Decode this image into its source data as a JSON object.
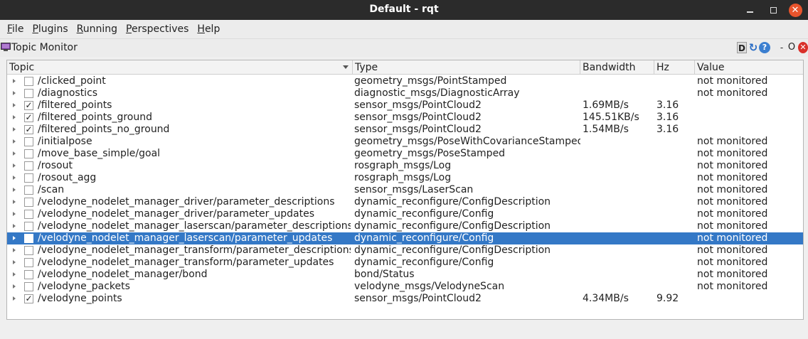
{
  "window": {
    "title": "Default - rqt",
    "minimize_glyph": "",
    "close_glyph": "✕"
  },
  "menu": [
    {
      "accel": "F",
      "rest": "ile"
    },
    {
      "accel": "P",
      "rest": "lugins"
    },
    {
      "accel": "R",
      "rest": "unning"
    },
    {
      "accel": "P",
      "rest": "erspectives"
    },
    {
      "accel": "H",
      "rest": "elp"
    }
  ],
  "plugin": {
    "title": "Topic Monitor",
    "d_label": "D",
    "reload_glyph": "↻",
    "help_glyph": "?",
    "dash_glyph": "-",
    "o_glyph": "O",
    "close_glyph": "✕"
  },
  "table": {
    "headers": {
      "topic": "Topic",
      "type": "Type",
      "bandwidth": "Bandwidth",
      "hz": "Hz",
      "value": "Value"
    },
    "rows": [
      {
        "checked": false,
        "topic": "/clicked_point",
        "type": "geometry_msgs/PointStamped",
        "bandwidth": "",
        "hz": "",
        "value": "not monitored"
      },
      {
        "checked": false,
        "topic": "/diagnostics",
        "type": "diagnostic_msgs/DiagnosticArray",
        "bandwidth": "",
        "hz": "",
        "value": "not monitored"
      },
      {
        "checked": true,
        "topic": "/filtered_points",
        "type": "sensor_msgs/PointCloud2",
        "bandwidth": "1.69MB/s",
        "hz": "3.16",
        "value": ""
      },
      {
        "checked": true,
        "topic": "/filtered_points_ground",
        "type": "sensor_msgs/PointCloud2",
        "bandwidth": "145.51KB/s",
        "hz": "3.16",
        "value": ""
      },
      {
        "checked": true,
        "topic": "/filtered_points_no_ground",
        "type": "sensor_msgs/PointCloud2",
        "bandwidth": "1.54MB/s",
        "hz": "3.16",
        "value": ""
      },
      {
        "checked": false,
        "topic": "/initialpose",
        "type": "geometry_msgs/PoseWithCovarianceStamped",
        "bandwidth": "",
        "hz": "",
        "value": "not monitored"
      },
      {
        "checked": false,
        "topic": "/move_base_simple/goal",
        "type": "geometry_msgs/PoseStamped",
        "bandwidth": "",
        "hz": "",
        "value": "not monitored"
      },
      {
        "checked": false,
        "topic": "/rosout",
        "type": "rosgraph_msgs/Log",
        "bandwidth": "",
        "hz": "",
        "value": "not monitored"
      },
      {
        "checked": false,
        "topic": "/rosout_agg",
        "type": "rosgraph_msgs/Log",
        "bandwidth": "",
        "hz": "",
        "value": "not monitored"
      },
      {
        "checked": false,
        "topic": "/scan",
        "type": "sensor_msgs/LaserScan",
        "bandwidth": "",
        "hz": "",
        "value": "not monitored"
      },
      {
        "checked": false,
        "topic": "/velodyne_nodelet_manager_driver/parameter_descriptions",
        "type": "dynamic_reconfigure/ConfigDescription",
        "bandwidth": "",
        "hz": "",
        "value": "not monitored"
      },
      {
        "checked": false,
        "topic": "/velodyne_nodelet_manager_driver/parameter_updates",
        "type": "dynamic_reconfigure/Config",
        "bandwidth": "",
        "hz": "",
        "value": "not monitored"
      },
      {
        "checked": false,
        "topic": "/velodyne_nodelet_manager_laserscan/parameter_descriptions",
        "type": "dynamic_reconfigure/ConfigDescription",
        "bandwidth": "",
        "hz": "",
        "value": "not monitored"
      },
      {
        "checked": false,
        "selected": true,
        "topic": "/velodyne_nodelet_manager_laserscan/parameter_updates",
        "type": "dynamic_reconfigure/Config",
        "bandwidth": "",
        "hz": "",
        "value": "not monitored"
      },
      {
        "checked": false,
        "topic": "/velodyne_nodelet_manager_transform/parameter_descriptions",
        "type": "dynamic_reconfigure/ConfigDescription",
        "bandwidth": "",
        "hz": "",
        "value": "not monitored"
      },
      {
        "checked": false,
        "topic": "/velodyne_nodelet_manager_transform/parameter_updates",
        "type": "dynamic_reconfigure/Config",
        "bandwidth": "",
        "hz": "",
        "value": "not monitored"
      },
      {
        "checked": false,
        "topic": "/velodyne_nodelet_manager/bond",
        "type": "bond/Status",
        "bandwidth": "",
        "hz": "",
        "value": "not monitored"
      },
      {
        "checked": false,
        "topic": "/velodyne_packets",
        "type": "velodyne_msgs/VelodyneScan",
        "bandwidth": "",
        "hz": "",
        "value": "not monitored"
      },
      {
        "checked": true,
        "topic": "/velodyne_points",
        "type": "sensor_msgs/PointCloud2",
        "bandwidth": "4.34MB/s",
        "hz": "9.92",
        "value": ""
      }
    ]
  },
  "colors": {
    "titlebar": "#2b2b2b",
    "selection": "#3478c6",
    "close_button": "#e9542c"
  }
}
